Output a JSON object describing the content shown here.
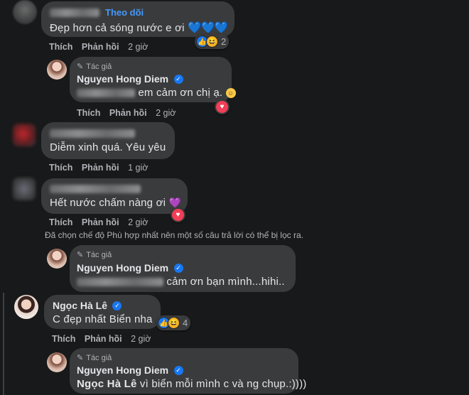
{
  "comment1": {
    "follow": "Theo dõi",
    "text": "Đẹp hơn cả sóng nước e ơi",
    "hearts": "💙💙💙",
    "reaction_count": "2",
    "like": "Thích",
    "reply": "Phản hồi",
    "time": "2 giờ"
  },
  "reply1": {
    "author_tag": "Tác giả",
    "name": "Nguyen Hong Diem",
    "text": "em cảm ơn chị ạ.",
    "like": "Thích",
    "reply": "Phản hồi",
    "time": "2 giờ"
  },
  "comment2": {
    "text": "Diễm xinh quá. Yêu yêu",
    "like": "Thích",
    "reply": "Phản hồi",
    "time": "1 giờ"
  },
  "comment3": {
    "text": "Hết nước chấm nàng ơi",
    "heart": "💜",
    "like": "Thích",
    "reply": "Phản hồi",
    "time": "2 giờ"
  },
  "filter_note": "Đã chọn chế độ Phù hợp nhất nên một số câu trả lời có thể bị lọc ra.",
  "reply2": {
    "author_tag": "Tác giả",
    "name": "Nguyen Hong Diem",
    "text": "cảm ơn bạn mình...hihi.."
  },
  "comment4": {
    "name": "Ngọc Hà Lê",
    "text": "C đẹp nhất Biển nha",
    "reaction_count": "4",
    "like": "Thích",
    "reply": "Phản hồi",
    "time": "2 giờ"
  },
  "reply3": {
    "author_tag": "Tác giả",
    "name": "Nguyen Hong Diem",
    "mention": "Ngọc Hà Lê",
    "text": "vì biển mỗi mình c và ng chụp.:))))"
  },
  "icons": {
    "verified": "✓",
    "pen": "✎",
    "like": "👍",
    "haha": "😆",
    "love": "♥"
  },
  "colors": {
    "background": "#18191a",
    "bubble": "#3a3b3c",
    "link": "#4599ff",
    "verified": "#1877f2",
    "love": "#f33e58"
  }
}
